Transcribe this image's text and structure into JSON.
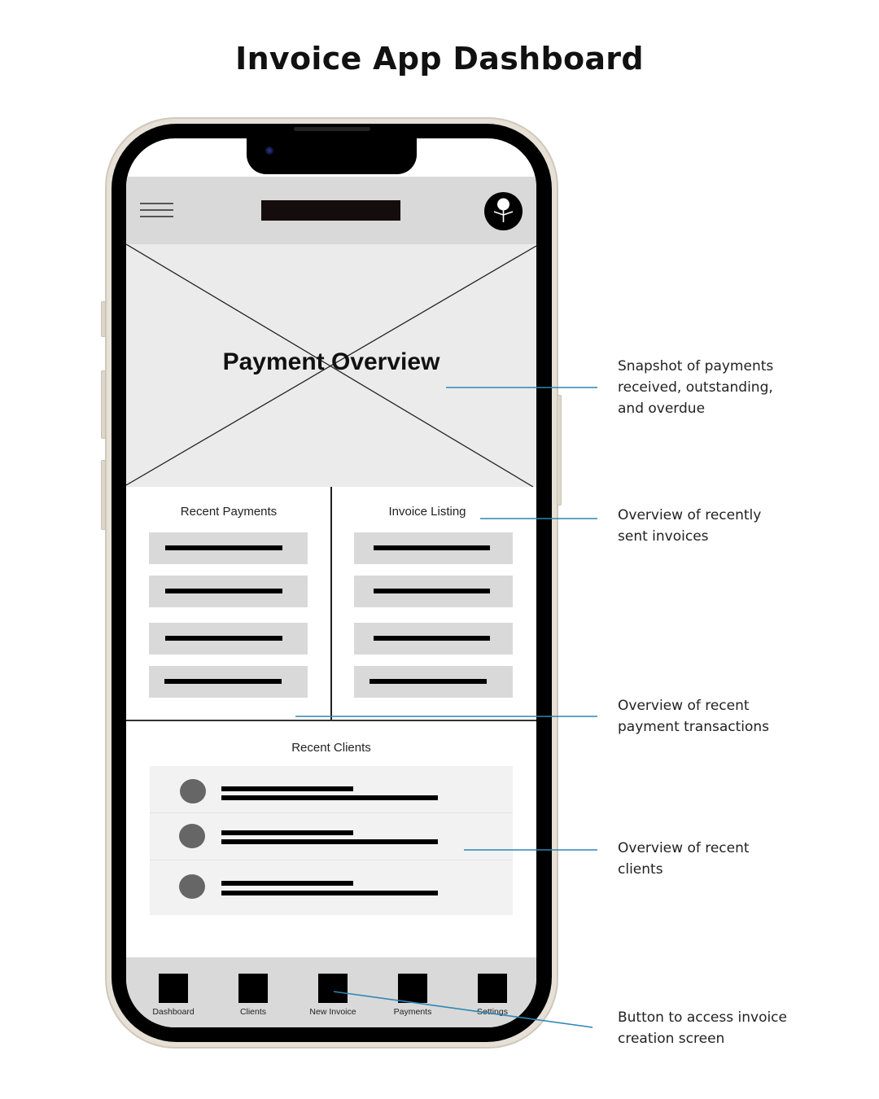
{
  "page": {
    "title": "Invoice App Dashboard"
  },
  "colors": {
    "leader_line": "#2f86b3",
    "phone_frame": "#e6e0d6",
    "header_bg": "#d9d9d9",
    "overview_bg": "#ebebeb",
    "list_bar_bg": "#d9d9d9",
    "client_row_bg": "#f2f2f2",
    "client_avatar": "#666666"
  },
  "app": {
    "header": {
      "menu_icon": "hamburger-menu-icon",
      "title_placeholder": "title-bar-placeholder",
      "profile_icon": "user-profile-icon"
    },
    "overview": {
      "label": "Payment Overview",
      "placeholder": "image-placeholder-x"
    },
    "recent_payments": {
      "title": "Recent Payments",
      "item_count": 4
    },
    "invoice_listing": {
      "title": "Invoice Listing",
      "item_count": 4
    },
    "recent_clients": {
      "title": "Recent Clients",
      "item_count": 3
    },
    "tabbar": {
      "tabs": [
        {
          "label": "Dashboard",
          "icon": "dashboard-icon"
        },
        {
          "label": "Clients",
          "icon": "clients-icon"
        },
        {
          "label": "New Invoice",
          "icon": "new-invoice-icon"
        },
        {
          "label": "Payments",
          "icon": "payments-icon"
        },
        {
          "label": "Settings",
          "icon": "settings-icon"
        }
      ]
    }
  },
  "annotations": [
    {
      "text": "Snapshot of payments received, outstanding, and overdue",
      "lines": [
        "Snapshot of payments",
        "received, outstanding,",
        "and overdue"
      ]
    },
    {
      "text": "Overview of recently sent invoices",
      "lines": [
        "Overview of recently",
        "sent invoices"
      ]
    },
    {
      "text": "Overview of recent payment transactions",
      "lines": [
        "Overview of recent",
        "payment transactions"
      ]
    },
    {
      "text": "Overview of recent clients",
      "lines": [
        "Overview of recent",
        "clients"
      ]
    },
    {
      "text": "Button to access invoice creation screen",
      "lines": [
        "Button to access invoice",
        "creation screen"
      ]
    }
  ]
}
